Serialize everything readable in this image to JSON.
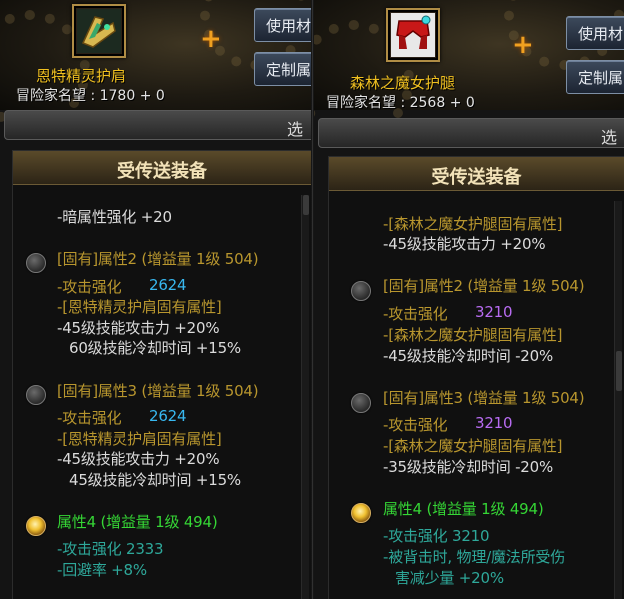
{
  "left": {
    "item_name": "恩特精灵护肩",
    "fame_label": "冒险家名望 : 1780 + 0",
    "buttons": [
      "使用材",
      "定制属"
    ],
    "select_label": "选",
    "list_title": "受传送装备",
    "lines": [
      "-暗属性强化 +20",
      "[固有]属性2 (增益量 1级 504)",
      "-攻击强化",
      "2624",
      "-[恩特精灵护肩固有属性]",
      "-45级技能攻击力 +20%",
      "60级技能冷却时间 +15%",
      "[固有]属性3 (增益量 1级 504)",
      "-攻击强化",
      "2624",
      "-[恩特精灵护肩固有属性]",
      "-45级技能攻击力 +20%",
      "45级技能冷却时间 +15%",
      "属性4 (增益量 1级 494)",
      "-攻击强化 2333",
      "-回避率 +8%"
    ]
  },
  "right": {
    "item_name": "森林之魔女护腿",
    "fame_label": "冒险家名望 : 2568 + 0",
    "buttons": [
      "使用材",
      "定制属"
    ],
    "select_label": "选",
    "list_title": "受传送装备",
    "lines": [
      "-[森林之魔女护腿固有属性]",
      "-45级技能攻击力 +20%",
      "[固有]属性2 (增益量 1级 504)",
      "-攻击强化",
      "3210",
      "-[森林之魔女护腿固有属性]",
      "-45级技能冷却时间 -20%",
      "[固有]属性3 (增益量 1级 504)",
      "-攻击强化",
      "3210",
      "-[森林之魔女护腿固有属性]",
      "-35级技能冷却时间 -20%",
      "属性4 (增益量 1级 494)",
      "-攻击强化 3210",
      "-被背击时, 物理/魔法所受伤",
      "害减少量 +20%"
    ]
  },
  "icons": {
    "left_item": "pauldron-item-icon",
    "right_item": "leggings-item-icon",
    "plus": "plus-icon"
  },
  "colors": {
    "item_name": "#f0c020",
    "option_header": "#b8962e",
    "selected_option": "#35d635",
    "attack_value_left": "#38b8f0",
    "attack_value_right": "#b86cf2"
  }
}
